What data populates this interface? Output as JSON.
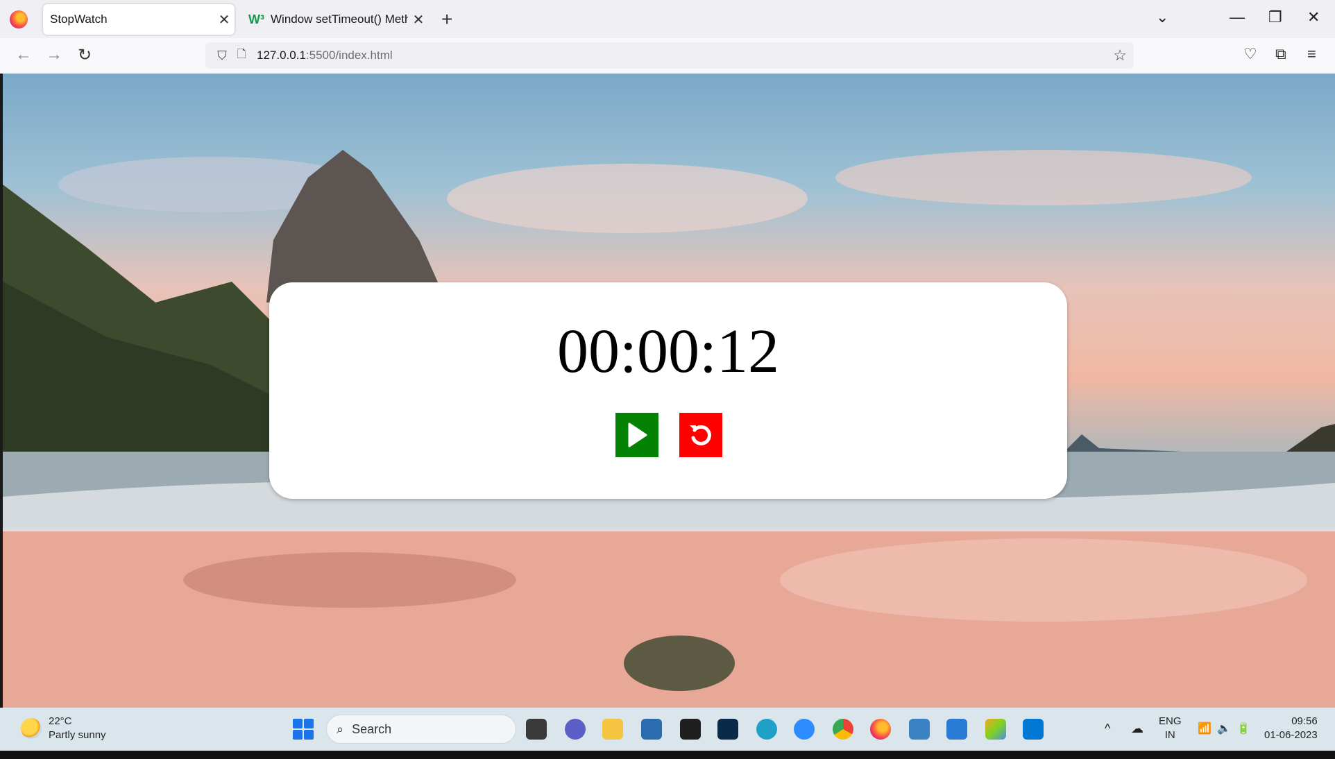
{
  "browser": {
    "tabs": [
      {
        "title": "StopWatch",
        "active": true
      },
      {
        "title": "Window setTimeout() Method",
        "active": false
      }
    ],
    "url_host": "127.0.0.1",
    "url_path": ":5500/index.html"
  },
  "stopwatch": {
    "time": "00:00:12",
    "play_color": "#038203",
    "reset_color": "#fe0000"
  },
  "taskbar": {
    "weather_temp": "22°C",
    "weather_desc": "Partly sunny",
    "search_label": "Search",
    "lang_top": "ENG",
    "lang_bottom": "IN",
    "time": "09:56",
    "date": "01-06-2023",
    "apps": [
      "task-view-icon",
      "teams-icon",
      "file-explorer-icon",
      "store-icon",
      "dropbox-icon",
      "app-icon",
      "edge-icon",
      "zoom-icon",
      "chrome-icon",
      "firefox-icon",
      "notepad-icon",
      "photos-icon",
      "app2-icon",
      "vscode-icon"
    ]
  }
}
